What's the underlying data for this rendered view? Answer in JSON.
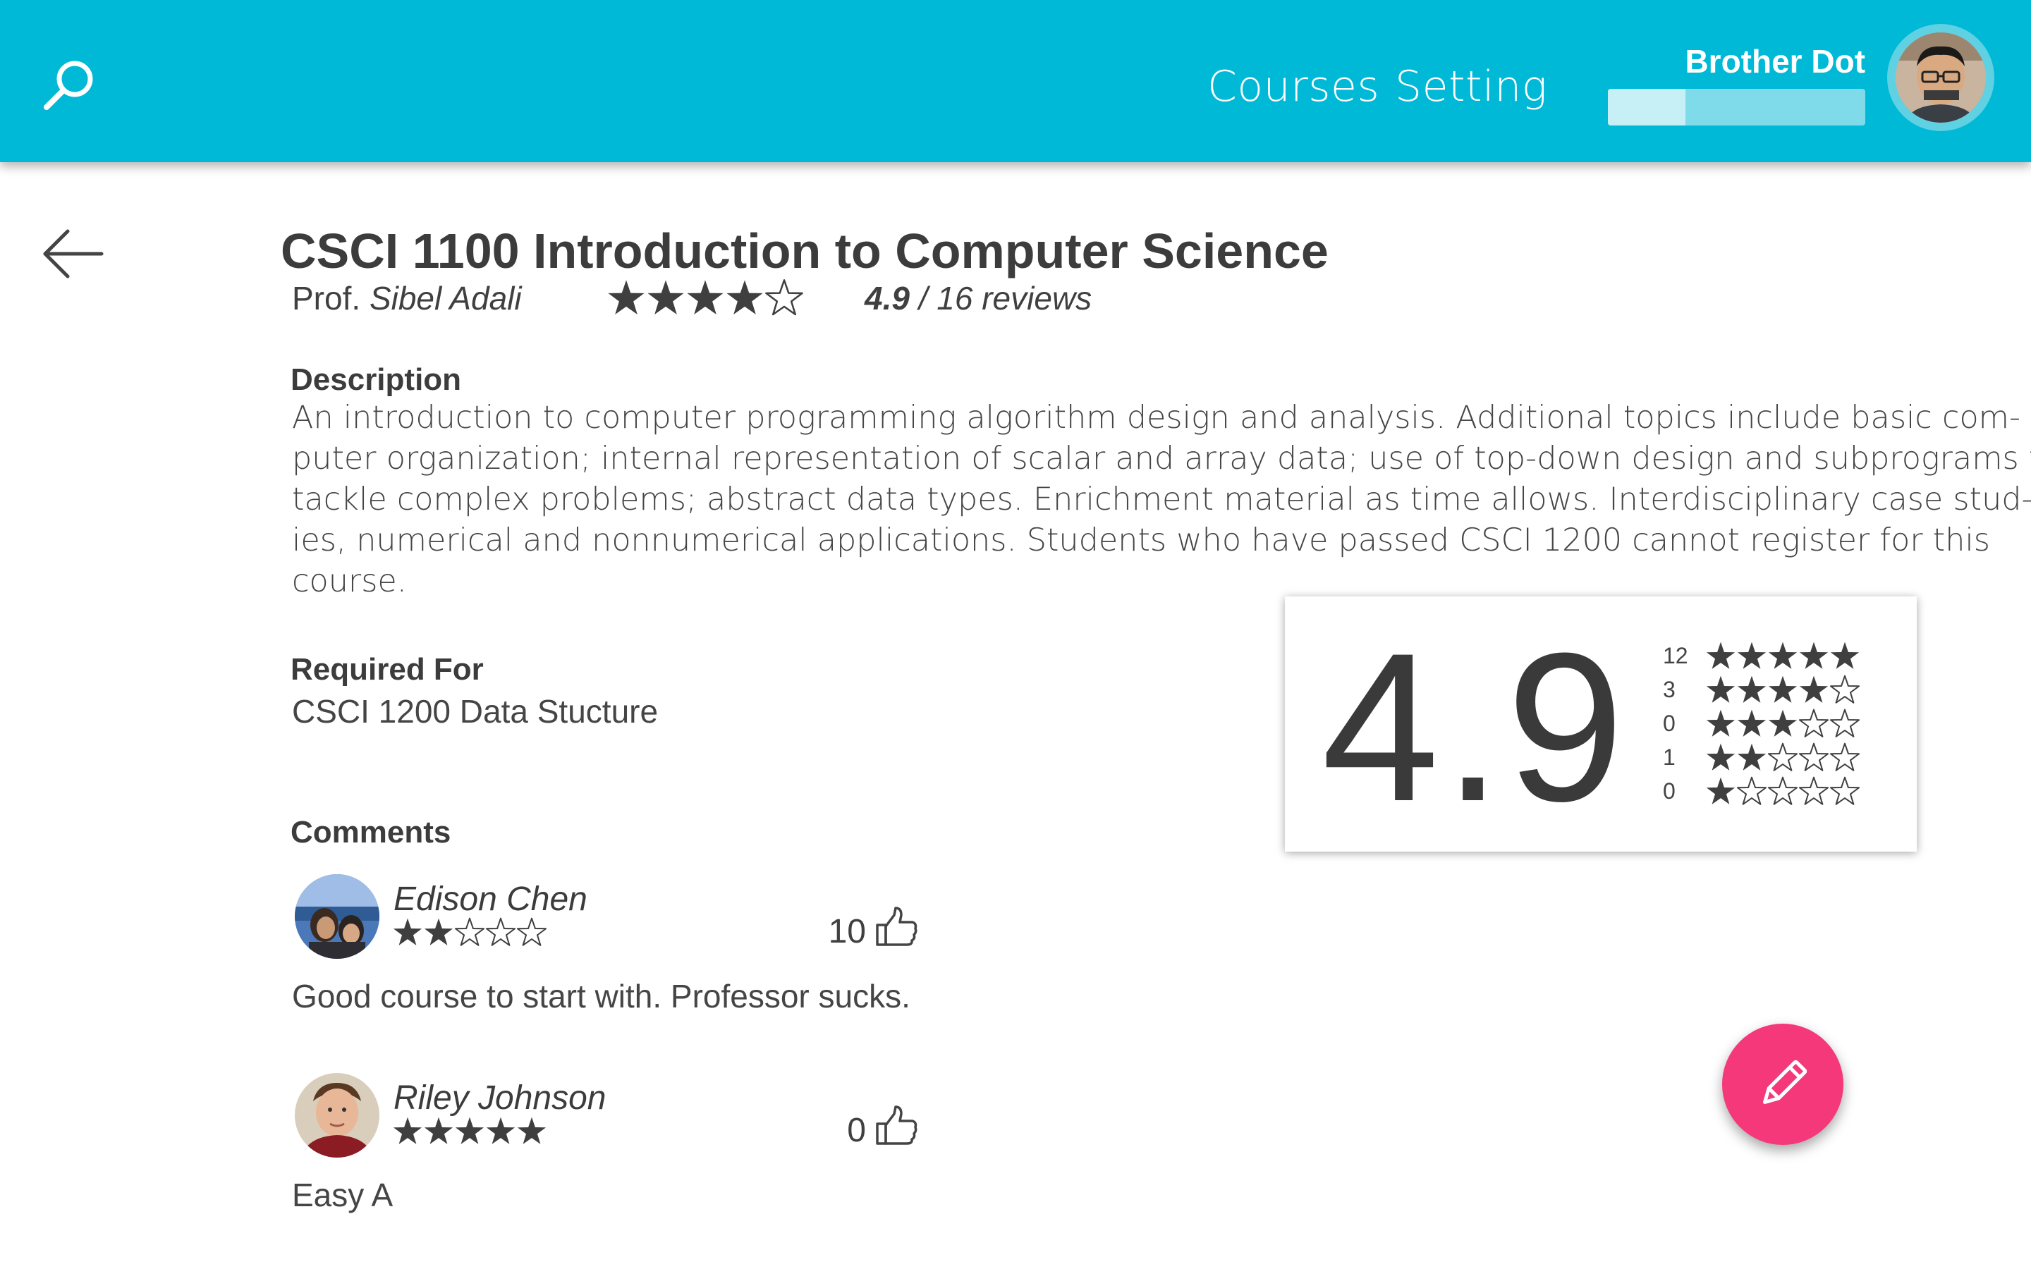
{
  "nav": {
    "links": [
      "Courses",
      "Setting"
    ]
  },
  "user": {
    "name": "Brother Dot",
    "progress_fraction": 0.3
  },
  "course": {
    "title": "CSCI 1100 Introduction to Computer Science",
    "prof_prefix": "Prof.",
    "prof_name": "Sibel Adali",
    "stars": 4,
    "rating": "4.9",
    "reviews": "/ 16 reviews"
  },
  "description": {
    "heading": "Description",
    "lines": [
      "An introduction to computer programming algorithm design and analysis. Additional topics include basic com-",
      "puter organization; internal representation of scalar and array data; use of top-down design and subprograms to",
      "tackle complex problems; abstract data types. Enrichment material as time allows. Interdisciplinary case stud-",
      "ies, numerical and nonnumerical applications. Students who have passed CSCI 1200 cannot register for this",
      "course."
    ]
  },
  "required_for": {
    "heading": "Required For",
    "text": "CSCI 1200 Data Stucture"
  },
  "rating_card": {
    "score": "4.9",
    "distribution": [
      {
        "count": "12",
        "stars": 5
      },
      {
        "count": "3",
        "stars": 4
      },
      {
        "count": "0",
        "stars": 3
      },
      {
        "count": "1",
        "stars": 2
      },
      {
        "count": "0",
        "stars": 1
      }
    ]
  },
  "comments": {
    "heading": "Comments",
    "items": [
      {
        "author": "Edison Chen",
        "stars": 2,
        "likes": "10",
        "text": "Good course to start with. Professor sucks."
      },
      {
        "author": "Riley Johnson",
        "stars": 5,
        "likes": "0",
        "text": "Easy A"
      }
    ]
  },
  "colors": {
    "topbar": "#00b9d6",
    "fab": "#f5387a",
    "text": "#404040"
  },
  "icons": {
    "search": "search-icon",
    "back": "arrow-left-icon",
    "like": "thumbs-up-icon",
    "edit": "pencil-icon"
  }
}
